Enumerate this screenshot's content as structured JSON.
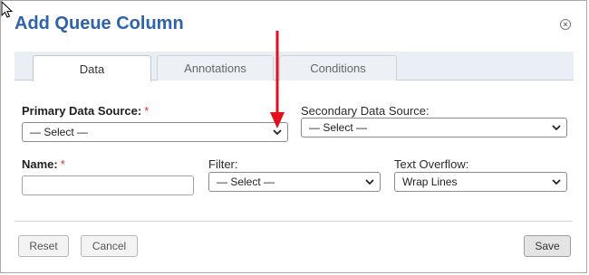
{
  "dialog": {
    "title": "Add Queue Column",
    "close_icon": "close-circle-icon"
  },
  "tabs": [
    {
      "label": "Data",
      "active": true
    },
    {
      "label": "Annotations",
      "active": false
    },
    {
      "label": "Conditions",
      "active": false
    }
  ],
  "form": {
    "primary_source": {
      "label": "Primary Data Source:",
      "required_mark": "*",
      "value": "— Select —"
    },
    "secondary_source": {
      "label": "Secondary Data Source:",
      "value": "— Select —"
    },
    "name": {
      "label": "Name:",
      "required_mark": "*",
      "value": ""
    },
    "filter": {
      "label": "Filter:",
      "value": "— Select —"
    },
    "text_overflow": {
      "label": "Text Overflow:",
      "value": "Wrap Lines"
    }
  },
  "buttons": {
    "reset": "Reset",
    "cancel": "Cancel",
    "save": "Save"
  },
  "colors": {
    "title": "#2f63a8",
    "required": "#dd3333",
    "annotation_arrow": "#e0101e"
  }
}
